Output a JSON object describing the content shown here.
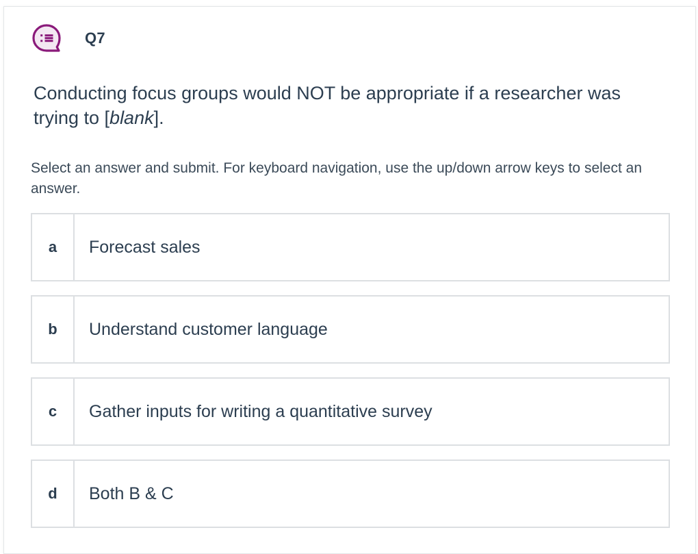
{
  "question": {
    "number": "Q7",
    "icon": "question-list-bubble-icon",
    "accent_color": "#8a1a7a",
    "text_before": "Conducting focus groups would NOT be appropriate if a researcher was trying to [",
    "text_blank": "blank",
    "text_after": "]."
  },
  "instructions": "Select an answer and submit. For keyboard navigation, use the up/down arrow keys to select an answer.",
  "options": [
    {
      "letter": "a",
      "text": "Forecast sales"
    },
    {
      "letter": "b",
      "text": "Understand customer language"
    },
    {
      "letter": "c",
      "text": "Gather inputs for writing a quantitative survey"
    },
    {
      "letter": "d",
      "text": "Both B & C"
    }
  ]
}
